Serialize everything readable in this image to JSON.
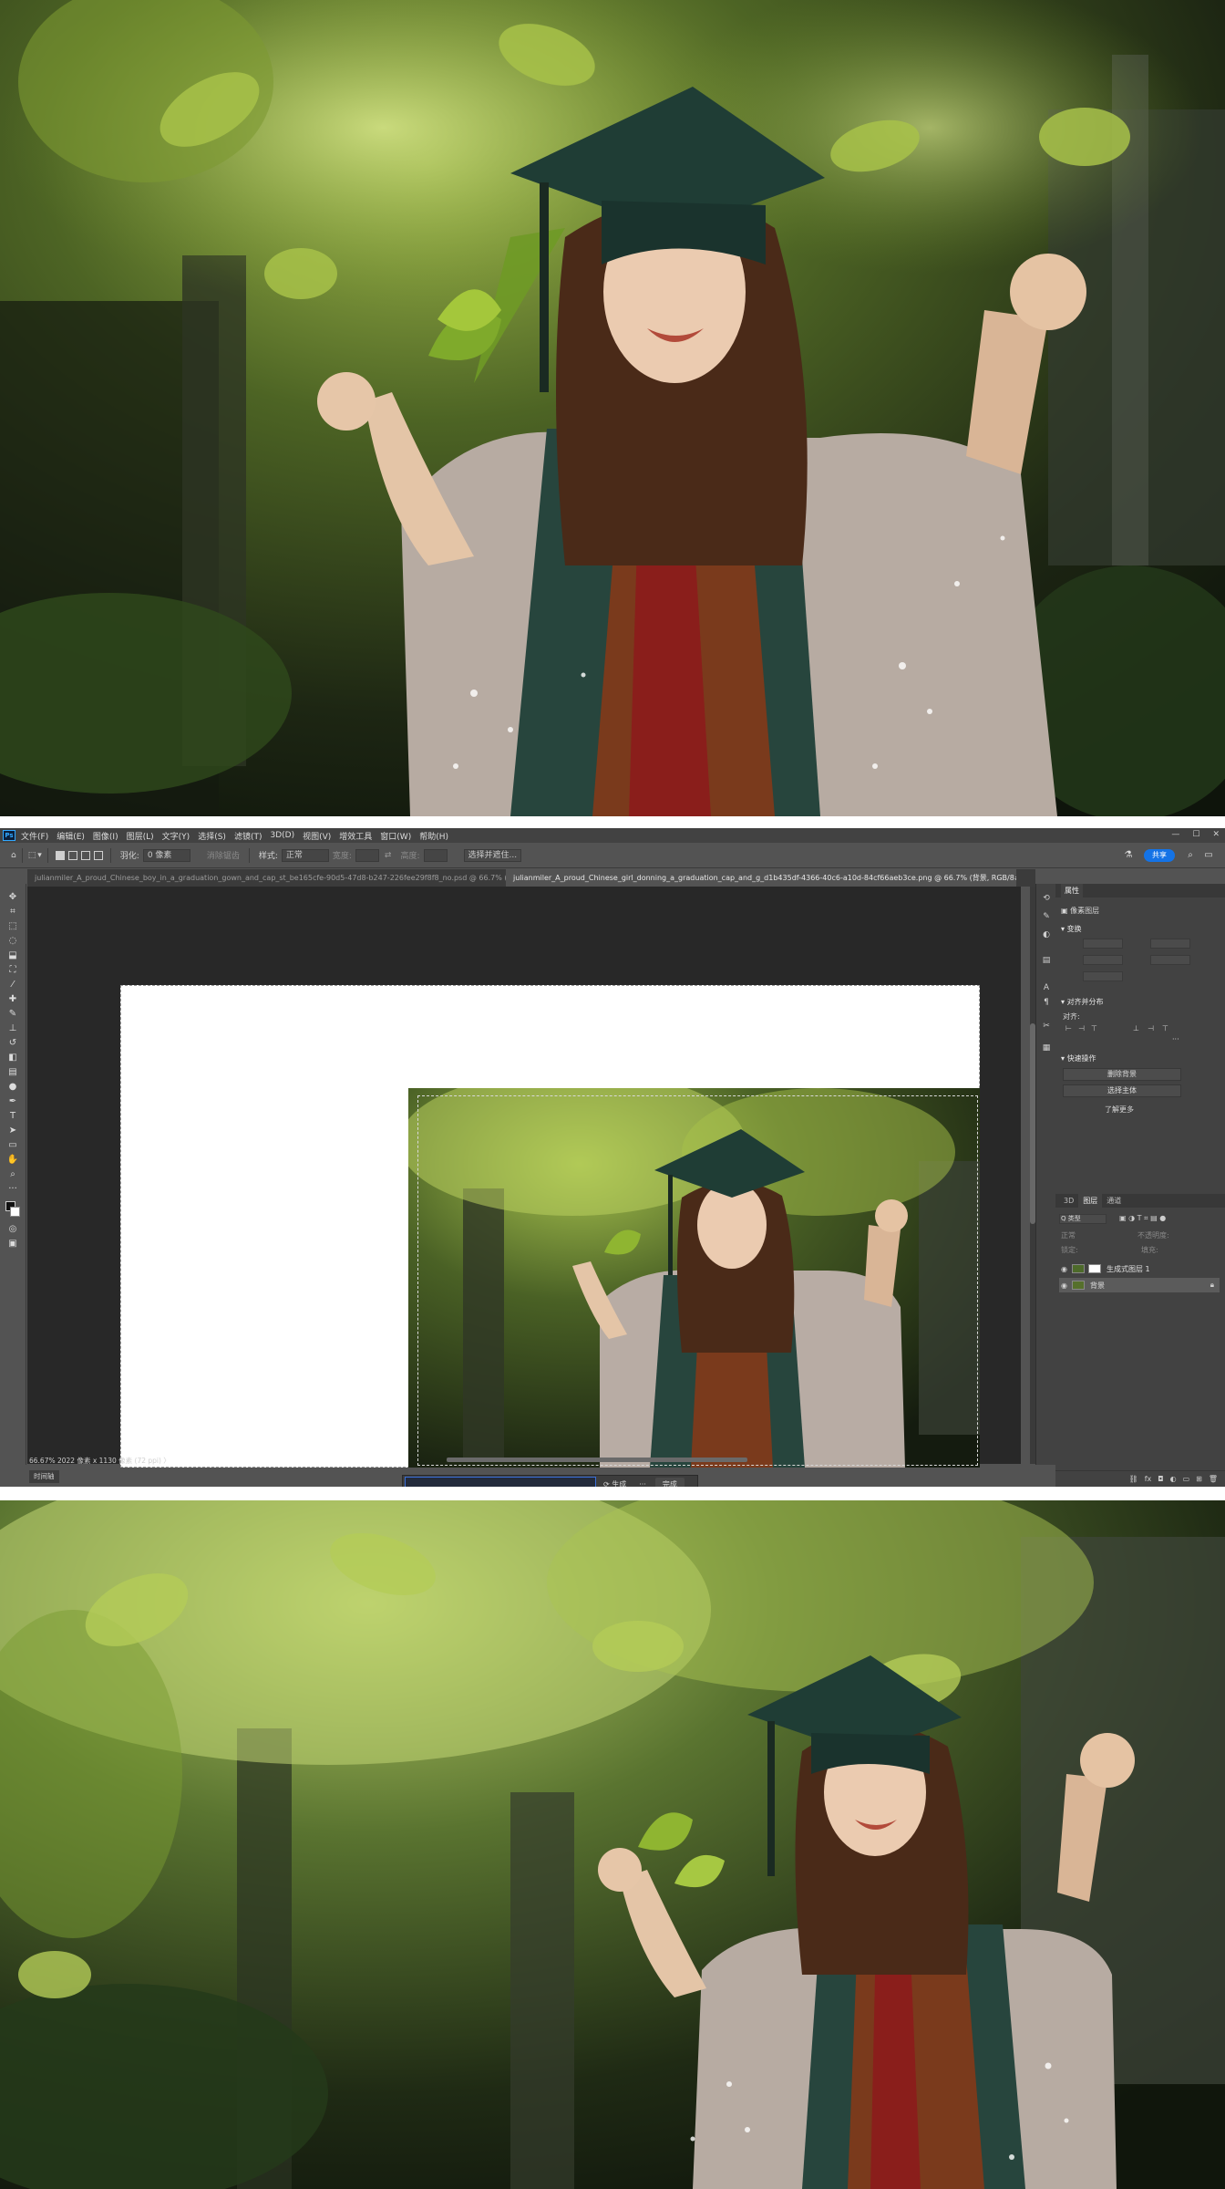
{
  "photoshop": {
    "menu": [
      "文件(F)",
      "编辑(E)",
      "图像(I)",
      "图层(L)",
      "文字(Y)",
      "选择(S)",
      "滤镜(T)",
      "3D(D)",
      "视图(V)",
      "增效工具",
      "窗口(W)",
      "帮助(H)"
    ],
    "options": {
      "feather_label": "羽化:",
      "feather_value": "0 像素",
      "antialias": "消除锯齿",
      "style_label": "样式:",
      "style_value": "正常",
      "width_label": "宽度:",
      "height_label": "高度:",
      "select_mask": "选择并遮住...",
      "share": "共享"
    },
    "tabs": [
      "julianmiler_A_proud_Chinese_boy_in_a_graduation_gown_and_cap_st_be165cfe-90d5-47d8-b247-226fee29f8f8_no.psd @ 66.7% (生成...",
      "julianmiler_A_proud_Chinese_girl_donning_a_graduation_cap_and_g_d1b435df-4366-40c6-a10d-84cf66aeb3ce.png @ 66.7% (背景, RGB/8#) *"
    ],
    "context_bar": {
      "generate": "生成",
      "more": "···",
      "done": "完成"
    },
    "status": "66.67%   2022 像素 x 1130 像素 (72 ppi)   〉",
    "bottom_tab": "时间轴",
    "properties": {
      "panel_title": "属性",
      "doc_label": "像素图层",
      "transform": "变换",
      "align": "对齐并分布",
      "align_sub": "对齐:",
      "quick_actions": "快速操作",
      "btn_remove_bg": "删除背景",
      "btn_select_subject": "选择主体",
      "more_link": "了解更多"
    },
    "layers": {
      "tabs": [
        "3D",
        "图层",
        "通道"
      ],
      "filter": "Q 类型",
      "mode": "正常",
      "opacity": "不透明度:",
      "lock": "锁定:",
      "fill": "填充:",
      "rows": [
        {
          "name": "生成式图层 1",
          "selected": false,
          "locked": false
        },
        {
          "name": "背景",
          "selected": true,
          "locked": true
        }
      ]
    }
  }
}
